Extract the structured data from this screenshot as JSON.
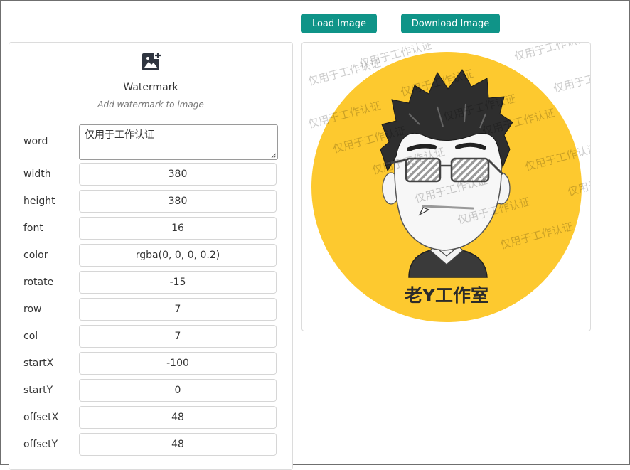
{
  "toolbar": {
    "load_label": "Load Image",
    "download_label": "Download Image"
  },
  "panel": {
    "title": "Watermark",
    "subtitle": "Add watermark to image",
    "icon": "add-image-icon"
  },
  "fields": {
    "word": {
      "label": "word",
      "value": "仅用于工作认证"
    },
    "width": {
      "label": "width",
      "value": "380"
    },
    "height": {
      "label": "height",
      "value": "380"
    },
    "font": {
      "label": "font",
      "value": "16"
    },
    "color": {
      "label": "color",
      "value": "rgba(0, 0, 0, 0.2)"
    },
    "rotate": {
      "label": "rotate",
      "value": "-15"
    },
    "row": {
      "label": "row",
      "value": "7"
    },
    "col": {
      "label": "col",
      "value": "7"
    },
    "startX": {
      "label": "startX",
      "value": "-100"
    },
    "startY": {
      "label": "startY",
      "value": "0"
    },
    "offsetX": {
      "label": "offsetX",
      "value": "48"
    },
    "offsetY": {
      "label": "offsetY",
      "value": "48"
    }
  },
  "preview": {
    "caption": "老Y工作室",
    "watermark_text": "仅用于工作认证",
    "watermark_color": "rgba(0, 0, 0, 0.2)",
    "watermark_rotate": -15,
    "circle_color": "#fdc92f"
  },
  "colors": {
    "accent": "#0f9488",
    "circle": "#fdc92f"
  }
}
